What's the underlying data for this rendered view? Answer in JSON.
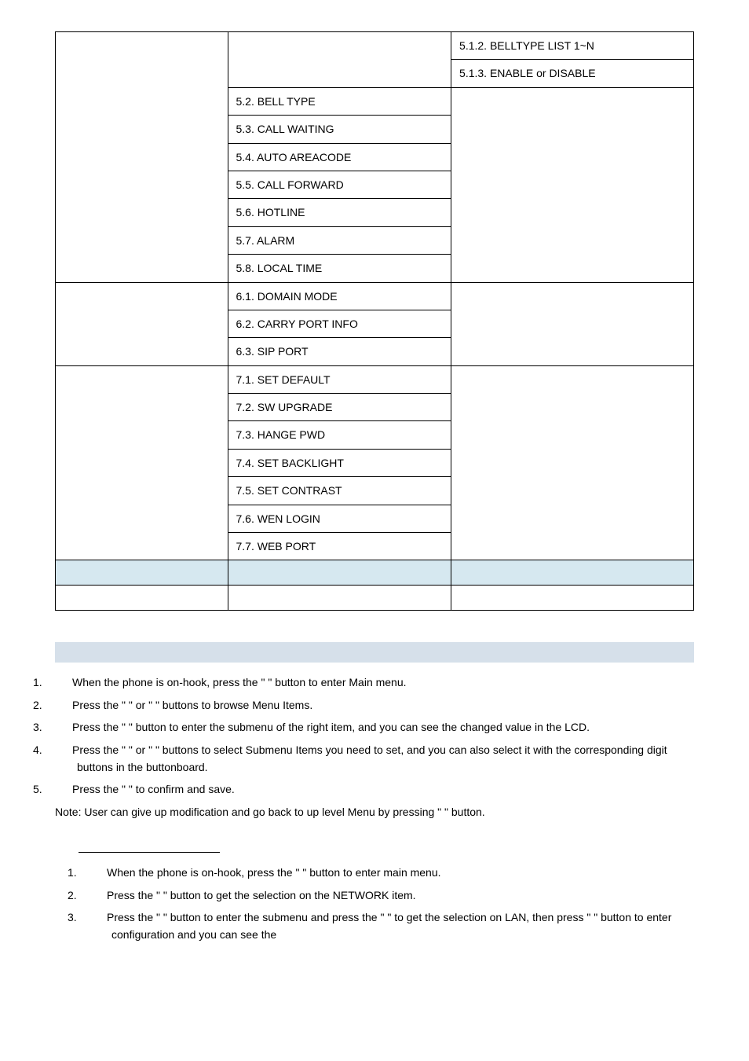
{
  "table": {
    "r1c3": "5.1.2. BELLTYPE LIST 1~N",
    "r2c3": "5.1.3. ENABLE or DISABLE",
    "r3c2": "5.2. BELL TYPE",
    "r4c2": "5.3. CALL WAITING",
    "r5c2": "5.4. AUTO AREACODE",
    "r6c2": "5.5. CALL FORWARD",
    "r7c2": "5.6. HOTLINE",
    "r8c2": "5.7. ALARM",
    "r9c2": "5.8. LOCAL TIME",
    "r10c2": "6.1. DOMAIN MODE",
    "r11c2": "6.2. CARRY PORT INFO",
    "r12c2": "6.3. SIP PORT",
    "r13c2": "7.1. SET DEFAULT",
    "r14c2": "7.2. SW UPGRADE",
    "r15c2": "7.3. HANGE PWD",
    "r16c2": "7.4. SET BACKLIGHT",
    "r17c2": "7.5. SET CONTRAST",
    "r18c2": "7.6. WEN LOGIN",
    "r19c2": "7.7. WEB PORT"
  },
  "instructions": {
    "i1": "When the phone is on-hook, press the \"        \" button to enter Main menu.",
    "i2": "Press the \"              \" or \"                   \" buttons to browse Menu Items.",
    "i3": "Press the \"          \" button to enter the submenu of the right item, and you can see the changed value in the LCD.",
    "i4": "Press the \"              \" or \"                   \" buttons to select Submenu Items you need to set, and you can also select it with the corresponding digit buttons in the buttonboard.",
    "i5": "Press the \"           \" to confirm and save.",
    "note": "Note: User can give up modification and go back to up level Menu by pressing \"              \" button."
  },
  "sub": {
    "s1": "When the phone is on-hook, press the \"        \" button to enter main menu.",
    "s2": "Press the \"               \" button to get the selection on the NETWORK item.",
    "s3": "Press the \"          \" button to enter the submenu and press the \"                   \" to get the selection on LAN, then press \"          \" button to enter configuration and you can see the"
  },
  "nums": {
    "n1": "1.",
    "n2": "2.",
    "n3": "3.",
    "n4": "4.",
    "n5": "5."
  }
}
